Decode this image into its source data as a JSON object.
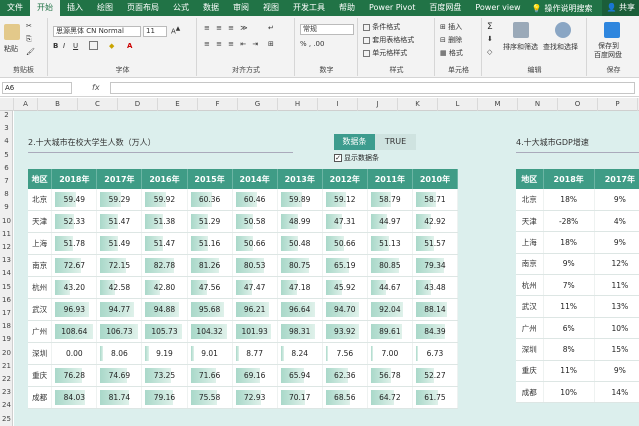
{
  "ribbon": {
    "tabs": [
      "文件",
      "开始",
      "插入",
      "绘图",
      "页面布局",
      "公式",
      "数据",
      "审阅",
      "视图",
      "开发工具",
      "帮助",
      "Power Pivot",
      "百度网盘",
      "Power view"
    ],
    "active_tab": "开始",
    "search_label": "操作说明搜索",
    "share_label": "共享",
    "paste_label": "粘贴",
    "clipboard_label": "剪贴板",
    "font_name": "思源黑体 CN Normal",
    "font_size": "11",
    "font_label": "字体",
    "align_label": "对齐方式",
    "number_format": "常规",
    "number_label": "数字",
    "cond_format": "条件格式",
    "table_format": "套用表格格式",
    "cell_style": "单元格样式",
    "styles_label": "样式",
    "insert_label": "插入",
    "delete_label": "删除",
    "format_label": "格式",
    "cells_label": "单元格",
    "sort_filter": "排序和筛选",
    "find_select": "查找和选择",
    "edit_label": "编辑",
    "save_label": "保存到",
    "save_label2": "百度网盘",
    "save_group": "保存"
  },
  "formula_bar": {
    "name_box": "A6",
    "fx": "fx",
    "formula": ""
  },
  "columns": [
    "A",
    "B",
    "C",
    "D",
    "E",
    "F",
    "G",
    "H",
    "I",
    "J",
    "K",
    "L",
    "M",
    "N",
    "O",
    "P"
  ],
  "rows": [
    "2",
    "3",
    "4",
    "5",
    "6",
    "7",
    "8",
    "9",
    "10",
    "11",
    "12",
    "13",
    "14",
    "15",
    "16",
    "17",
    "18",
    "19",
    "20",
    "21",
    "22",
    "23",
    "24",
    "25"
  ],
  "left_title": "2.十大城市在校大学生人数（万人）",
  "right_title": "4.十大城市GDP增速",
  "control": {
    "active": "数据条",
    "value": "TRUE",
    "checkbox_label": "显示数据条",
    "checked": "✓"
  },
  "students_table": {
    "headers": [
      "地区",
      "2018年",
      "2017年",
      "2016年",
      "2015年",
      "2014年",
      "2013年",
      "2012年",
      "2011年",
      "2010年"
    ],
    "rows": [
      {
        "city": "北京",
        "values": [
          "59.49",
          "59.29",
          "59.92",
          "60.36",
          "60.46",
          "59.89",
          "59.12",
          "58.79",
          "58.71"
        ]
      },
      {
        "city": "天津",
        "values": [
          "52.33",
          "51.47",
          "51.38",
          "51.29",
          "50.58",
          "48.99",
          "47.31",
          "44.97",
          "42.92"
        ]
      },
      {
        "city": "上海",
        "values": [
          "51.78",
          "51.49",
          "51.47",
          "51.16",
          "50.66",
          "50.48",
          "50.66",
          "51.13",
          "51.57"
        ]
      },
      {
        "city": "南京",
        "values": [
          "72.67",
          "72.15",
          "82.78",
          "81.26",
          "80.53",
          "80.75",
          "65.19",
          "80.85",
          "79.34"
        ]
      },
      {
        "city": "杭州",
        "values": [
          "43.20",
          "42.58",
          "42.80",
          "47.56",
          "47.47",
          "47.18",
          "45.92",
          "44.67",
          "43.48"
        ]
      },
      {
        "city": "武汉",
        "values": [
          "96.93",
          "94.77",
          "94.88",
          "95.68",
          "96.21",
          "96.64",
          "94.70",
          "92.04",
          "88.14"
        ]
      },
      {
        "city": "广州",
        "values": [
          "108.64",
          "106.73",
          "105.73",
          "104.32",
          "101.93",
          "98.31",
          "93.92",
          "89.61",
          "84.39"
        ]
      },
      {
        "city": "深圳",
        "values": [
          "0.00",
          "8.06",
          "9.19",
          "9.01",
          "8.77",
          "8.24",
          "7.56",
          "7.00",
          "6.73"
        ]
      },
      {
        "city": "重庆",
        "values": [
          "76.28",
          "74.69",
          "73.25",
          "71.66",
          "69.16",
          "65.94",
          "62.36",
          "56.78",
          "52.27"
        ]
      },
      {
        "city": "成都",
        "values": [
          "84.03",
          "81.74",
          "79.16",
          "75.58",
          "72.93",
          "70.17",
          "68.56",
          "64.72",
          "61.75"
        ]
      }
    ]
  },
  "gdp_table": {
    "headers": [
      "地区",
      "2018年",
      "2017年"
    ],
    "rows": [
      {
        "city": "北京",
        "values": [
          "18%",
          "9%"
        ]
      },
      {
        "city": "天津",
        "values": [
          "-28%",
          "4%"
        ]
      },
      {
        "city": "上海",
        "values": [
          "18%",
          "9%"
        ]
      },
      {
        "city": "南京",
        "values": [
          "9%",
          "12%"
        ]
      },
      {
        "city": "杭州",
        "values": [
          "7%",
          "11%"
        ]
      },
      {
        "city": "武汉",
        "values": [
          "11%",
          "13%"
        ]
      },
      {
        "city": "广州",
        "values": [
          "6%",
          "10%"
        ]
      },
      {
        "city": "深圳",
        "values": [
          "8%",
          "15%"
        ]
      },
      {
        "city": "重庆",
        "values": [
          "11%",
          "9%"
        ]
      },
      {
        "city": "成都",
        "values": [
          "10%",
          "14%"
        ]
      }
    ]
  },
  "colors": {
    "header": "#3f9c86",
    "sheet_bg": "#dcefed",
    "bar": "#a9d8c9",
    "excel_green": "#217346"
  }
}
